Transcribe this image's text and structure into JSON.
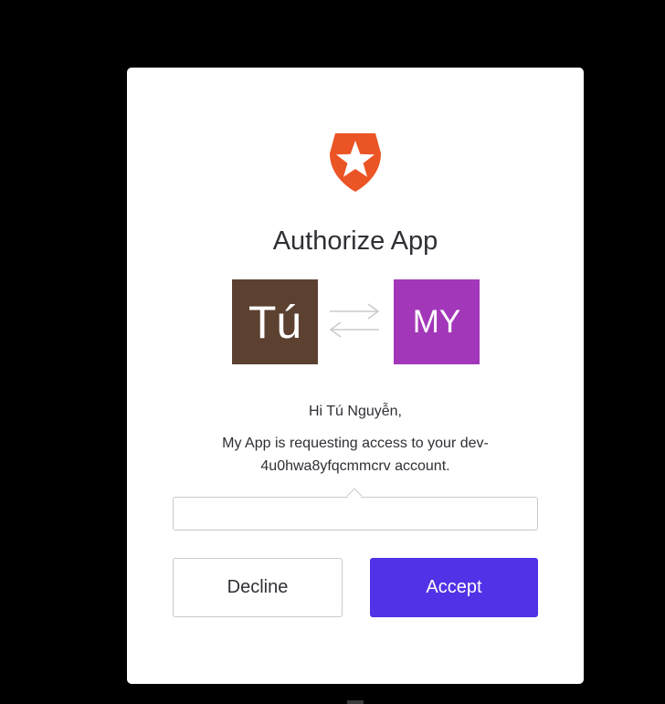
{
  "dialog": {
    "title": "Authorize App",
    "user_avatar": {
      "initials": "Tú",
      "color": "#5c4131"
    },
    "app_avatar": {
      "initials": "MY",
      "color": "#a337b9"
    },
    "greeting": "Hi Tú Nguyễn,",
    "message": "My App is requesting access to your dev-4u0hwa8yfqcmmcrv account.",
    "scopes_value": "",
    "decline_label": "Decline",
    "accept_label": "Accept"
  },
  "colors": {
    "background": "#000000",
    "card": "#ffffff",
    "accent": "#5231e6",
    "logo": "#eb5424",
    "text": "#2f2f35"
  },
  "icons": {
    "logo": "auth0-shield-star-icon",
    "swap": "swap-arrows-icon"
  }
}
